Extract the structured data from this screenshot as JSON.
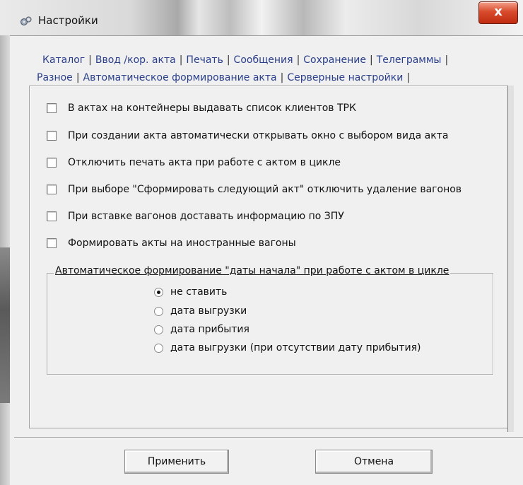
{
  "window": {
    "title": "Настройки",
    "close_label": "x"
  },
  "tabs_row1": [
    "Каталог",
    "Ввод /кор. акта",
    "Печать",
    "Сообщения",
    "Сохранение",
    "Телеграммы"
  ],
  "tabs_row2": [
    "Разное",
    "Автоматическое формирование акта",
    "Серверные настройки"
  ],
  "active_tab": "Разное",
  "options": [
    {
      "label": "В актах на контейнеры выдавать список клиентов ТРК",
      "checked": false
    },
    {
      "label": "При создании акта автоматически открывать окно с выбором вида акта",
      "checked": false
    },
    {
      "label": "Отключить печать акта при работе с актом в цикле",
      "checked": false
    },
    {
      "label": "При выборе \"Сформировать следующий акт\" отключить удаление вагонов",
      "checked": false
    },
    {
      "label": "При вставке вагонов доставать информацию по ЗПУ",
      "checked": false
    },
    {
      "label": "Формировать акты на иностранные вагоны",
      "checked": false
    }
  ],
  "group": {
    "legend": "Автоматическое формирование \"даты начала\" при работе с актом в цикле",
    "radios": [
      {
        "label": "не ставить",
        "selected": true
      },
      {
        "label": "дата выгрузки",
        "selected": false
      },
      {
        "label": "дата прибытия",
        "selected": false
      },
      {
        "label": "дата выгрузки (при отсутствии дату прибытия)",
        "selected": false
      }
    ]
  },
  "buttons": {
    "apply": "Применить",
    "cancel": "Отмена"
  }
}
